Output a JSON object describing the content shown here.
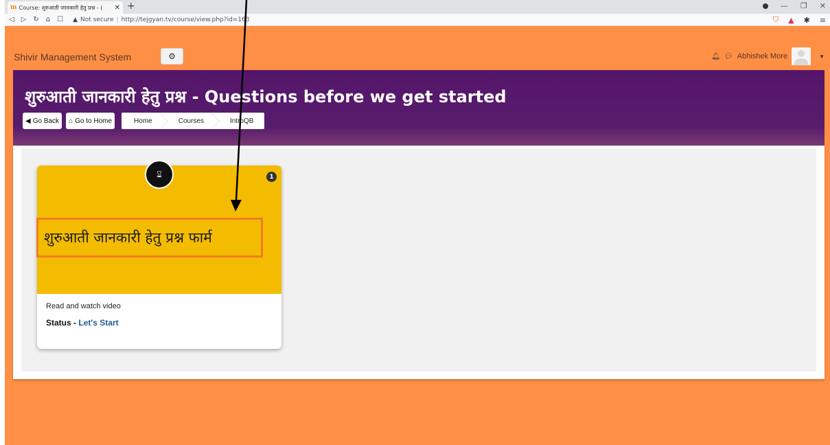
{
  "browser": {
    "tab_title": "Course: शुरुआती जानकारी हेतु प्रश्न - (",
    "security_label": "Not secure",
    "url": "http://tejgyan.tv/course/view.php?id=163"
  },
  "navbar": {
    "brand": "Shivir Management System",
    "user_name": "Abhishek More"
  },
  "header": {
    "title": "शुरुआती जानकारी हेतु प्रश्न - Questions before we get started",
    "go_back_label": "Go Back",
    "go_home_label": "Go to Home",
    "breadcrumb": [
      "Home",
      "Courses",
      "IntroQB"
    ]
  },
  "activity": {
    "title": "शुरुआती जानकारी हेतु प्रश्न फार्म",
    "description": "Read and watch video",
    "status_label": "Status",
    "status_sep": " - ",
    "status_value": "Let's Start",
    "badge_count": "1"
  },
  "colors": {
    "navbar_bg": "#ff8f45",
    "banner_bg": "#55166a",
    "card_top": "#f4bc00",
    "highlight_border": "#f07e23",
    "status_link": "#1f5c99"
  }
}
